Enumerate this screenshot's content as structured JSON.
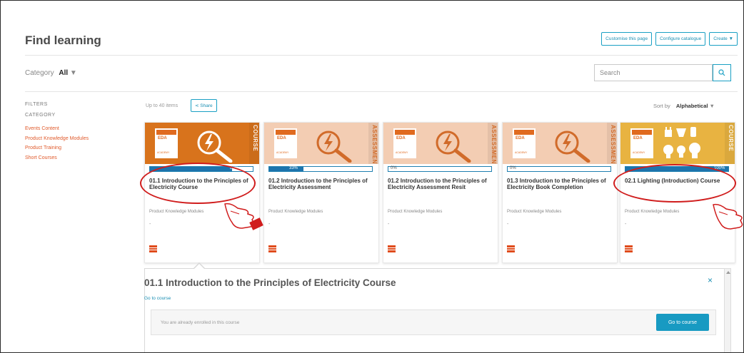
{
  "header": {
    "title": "Find learning",
    "buttons": [
      "Customise this page",
      "Configure catalogue",
      "Create ▼"
    ]
  },
  "toolbar": {
    "category_label": "Category",
    "category_value": "All",
    "search_placeholder": "Search"
  },
  "sidebar": {
    "filters_heading": "FILTERS",
    "category_heading": "CATEGORY",
    "items": [
      "Events Content",
      "Product Knowledge Modules",
      "Product Training",
      "Short Courses"
    ]
  },
  "listing": {
    "count": "Up to 40 items",
    "share_label": "Share",
    "sort_label": "Sort by",
    "sort_value": "Alphabetical"
  },
  "cards": [
    {
      "title": "01.1 Introduction to the Principles of Electricity Course",
      "category": "Product Knowledge Modules",
      "dash": "-",
      "progress_label": "80%",
      "progress": 0.8,
      "type_label": "COURSE",
      "banner": "orange"
    },
    {
      "title": "01.2 Introduction to the Principles of Electricity Assessment",
      "category": "Product Knowledge Modules",
      "dash": "-",
      "progress_label": "33%",
      "progress": 0.33,
      "type_label": "ASSESSMENT",
      "banner": "peach"
    },
    {
      "title": "01.2 Introduction to the Principles of Electricity Assessment Resit",
      "category": "Product Knowledge Modules",
      "dash": "-",
      "progress_label": "0%",
      "progress": 0,
      "type_label": "ASSESSMENT",
      "banner": "peach"
    },
    {
      "title": "01.3 Introduction to the Principles of Electricity Book Completion",
      "category": "Product Knowledge Modules",
      "dash": "-",
      "progress_label": "0%",
      "progress": 0,
      "type_label": "ASSESSMENT",
      "banner": "peach"
    },
    {
      "title": "02.1 Lighting (Introduction) Course",
      "category": "Product Knowledge Modules",
      "dash": "-",
      "progress_label": "100%",
      "progress": 1.0,
      "type_label": "COURSE",
      "banner": "yellow"
    }
  ],
  "logo": {
    "text": "EDA",
    "sub": "ACADEMY"
  },
  "detail": {
    "title": "01.1 Introduction to the Principles of Electricity Course",
    "link": "Go to course",
    "note": "You are already enrolled in this course",
    "button": "Go to course",
    "close": "×"
  },
  "colors": {
    "accent": "#1aa0c4",
    "link": "#e05a2b",
    "annotation": "#d01c1c"
  }
}
